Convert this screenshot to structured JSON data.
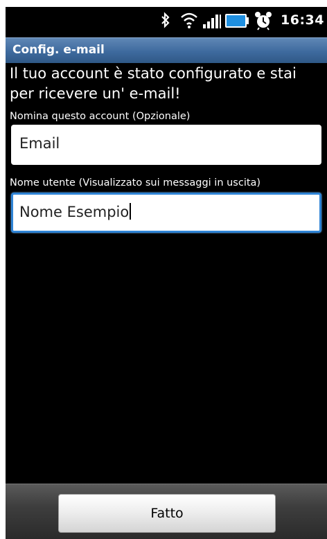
{
  "status_bar": {
    "time": "16:34",
    "icons": [
      "bluetooth-icon",
      "wifi-icon",
      "signal-icon",
      "battery-icon",
      "alarm-icon"
    ]
  },
  "title_bar": {
    "title": "Config. e-mail"
  },
  "content": {
    "message": "Il tuo account è stato configurato e stai per ricevere un' e-mail!",
    "account_name": {
      "label": "Nomina questo account (Opzionale)",
      "value": "Email"
    },
    "user_name": {
      "label": "Nome utente (Visualizzato sui messaggi in uscita)",
      "value": "Nome Esempio"
    }
  },
  "footer": {
    "done_label": "Fatto"
  },
  "colors": {
    "title_bar": "#3e6a9e",
    "focus_border": "#2f84d6",
    "background": "#000000"
  }
}
